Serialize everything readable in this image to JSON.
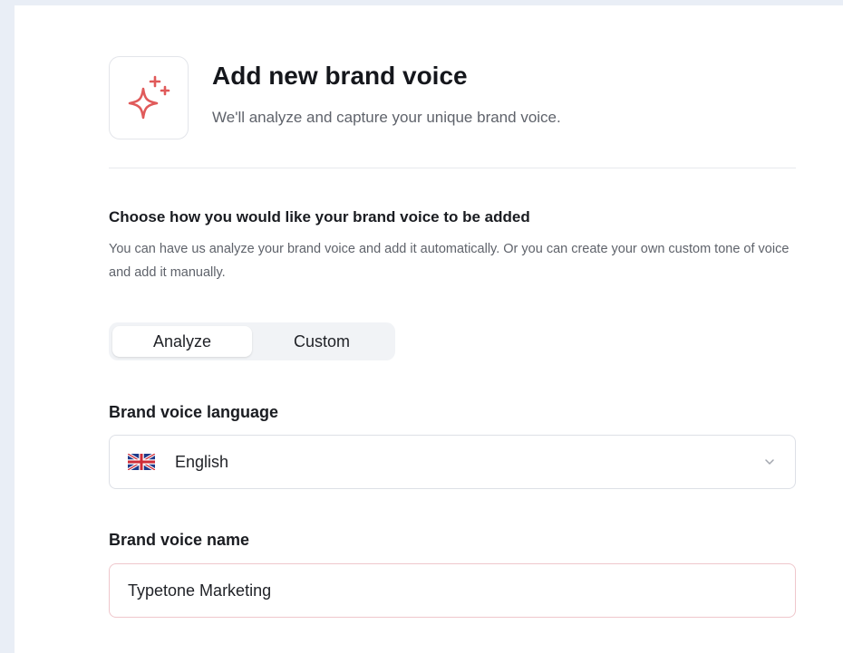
{
  "header": {
    "title": "Add new brand voice",
    "subtitle": "We'll analyze and capture your unique brand voice.",
    "icon": "sparkle-icon"
  },
  "method_section": {
    "title": "Choose how you would like your brand voice to be added",
    "description": "You can have us analyze your brand voice and add it automatically. Or you can create your own custom tone of voice and add it manually.",
    "options": [
      "Analyze",
      "Custom"
    ],
    "selected": "Analyze"
  },
  "language": {
    "label": "Brand voice language",
    "value": "English",
    "flag_icon": "uk-flag-icon"
  },
  "name_field": {
    "label": "Brand voice name",
    "value": "Typetone Marketing"
  },
  "colors": {
    "accent": "#e05a5a",
    "background": "#e9eef6"
  }
}
